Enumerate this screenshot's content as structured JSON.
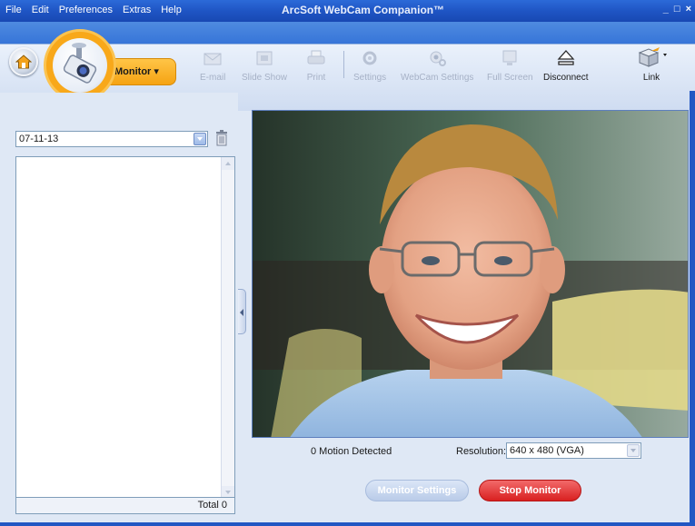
{
  "menu": {
    "items": [
      {
        "label": "File"
      },
      {
        "label": "Edit"
      },
      {
        "label": "Preferences"
      },
      {
        "label": "Extras"
      },
      {
        "label": "Help"
      }
    ]
  },
  "app": {
    "title": "ArcSoft WebCam Companion™",
    "minimize": "_",
    "maximize": "□",
    "close": "×"
  },
  "toolbar": {
    "mode_label": "Monitor ▾",
    "tools": [
      {
        "label": "E-mail",
        "icon": "email-icon",
        "enabled": false
      },
      {
        "label": "Slide Show",
        "icon": "slideshow-icon",
        "enabled": false
      },
      {
        "label": "Print",
        "icon": "print-icon",
        "enabled": false
      },
      {
        "label": "Settings",
        "icon": "settings-icon",
        "enabled": false
      },
      {
        "label": "WebCam Settings",
        "icon": "webcam-settings-icon",
        "enabled": false
      },
      {
        "label": "Full Screen",
        "icon": "fullscreen-icon",
        "enabled": false
      },
      {
        "label": "Disconnect",
        "icon": "eject-icon",
        "enabled": true
      },
      {
        "label": "Link",
        "icon": "link-box-icon",
        "enabled": true
      }
    ]
  },
  "left": {
    "date_value": "07-11-13",
    "total_label": "Total 0"
  },
  "status": {
    "motion_text": "0 Motion Detected",
    "resolution_label": "Resolution:",
    "resolution_value": "640 x 480 (VGA)"
  },
  "buttons": {
    "monitor_settings": "Monitor Settings",
    "stop_monitor": "Stop Monitor"
  },
  "colors": {
    "title_blue": "#1f55c4",
    "monitor_orange": "#f5a313",
    "stop_red": "#d92020"
  }
}
